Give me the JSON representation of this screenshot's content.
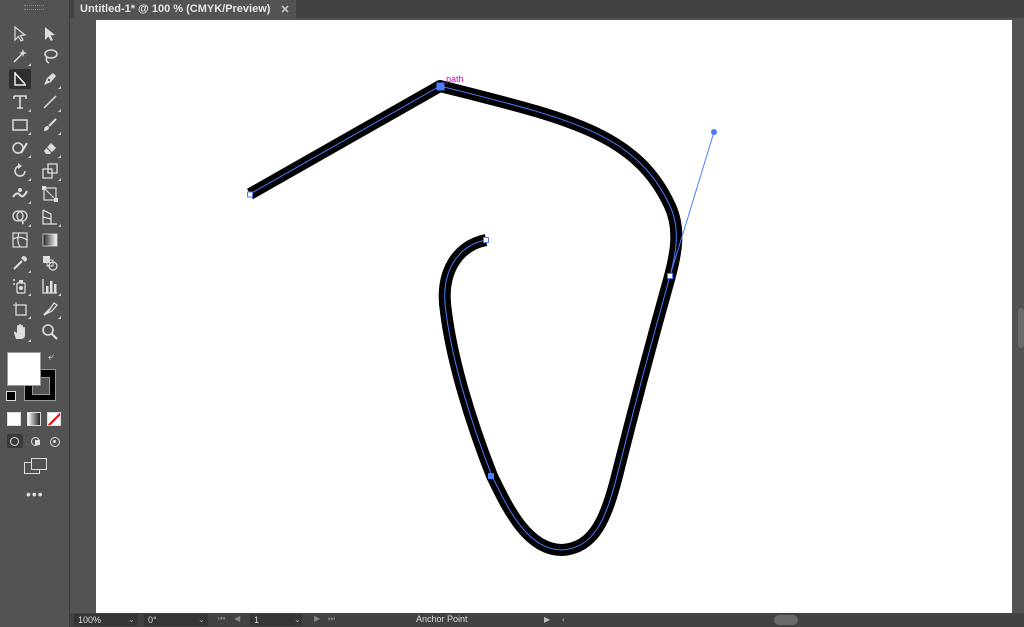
{
  "document": {
    "tab_title": "Untitled-1* @ 100 % (CMYK/Preview)",
    "close_glyph": "✕"
  },
  "status": {
    "zoom": "100%",
    "rotation": "0°",
    "artboard_number": "1",
    "tool_name": "Anchor Point"
  },
  "canvas": {
    "hint_label": "path"
  },
  "colors": {
    "ui_bg": "#535353",
    "path_stroke": "#000000",
    "path_highlight": "#4a7dff",
    "smart_guide": "#d400d4"
  },
  "tools": [
    "selection-tool",
    "direct-selection-tool",
    "magic-wand-tool",
    "lasso-tool",
    "anchor-point-tool",
    "pen-tool",
    "type-tool",
    "line-segment-tool",
    "rectangle-tool",
    "paintbrush-tool",
    "shaper-tool",
    "eraser-tool",
    "rotate-tool",
    "scale-tool",
    "puppet-warp-tool",
    "free-transform-tool",
    "shape-builder-tool",
    "perspective-grid-tool",
    "mesh-tool",
    "gradient-tool",
    "eyedropper-tool",
    "blend-tool",
    "symbol-sprayer-tool",
    "column-graph-tool",
    "artboard-tool",
    "slice-tool",
    "hand-tool",
    "zoom-tool"
  ]
}
